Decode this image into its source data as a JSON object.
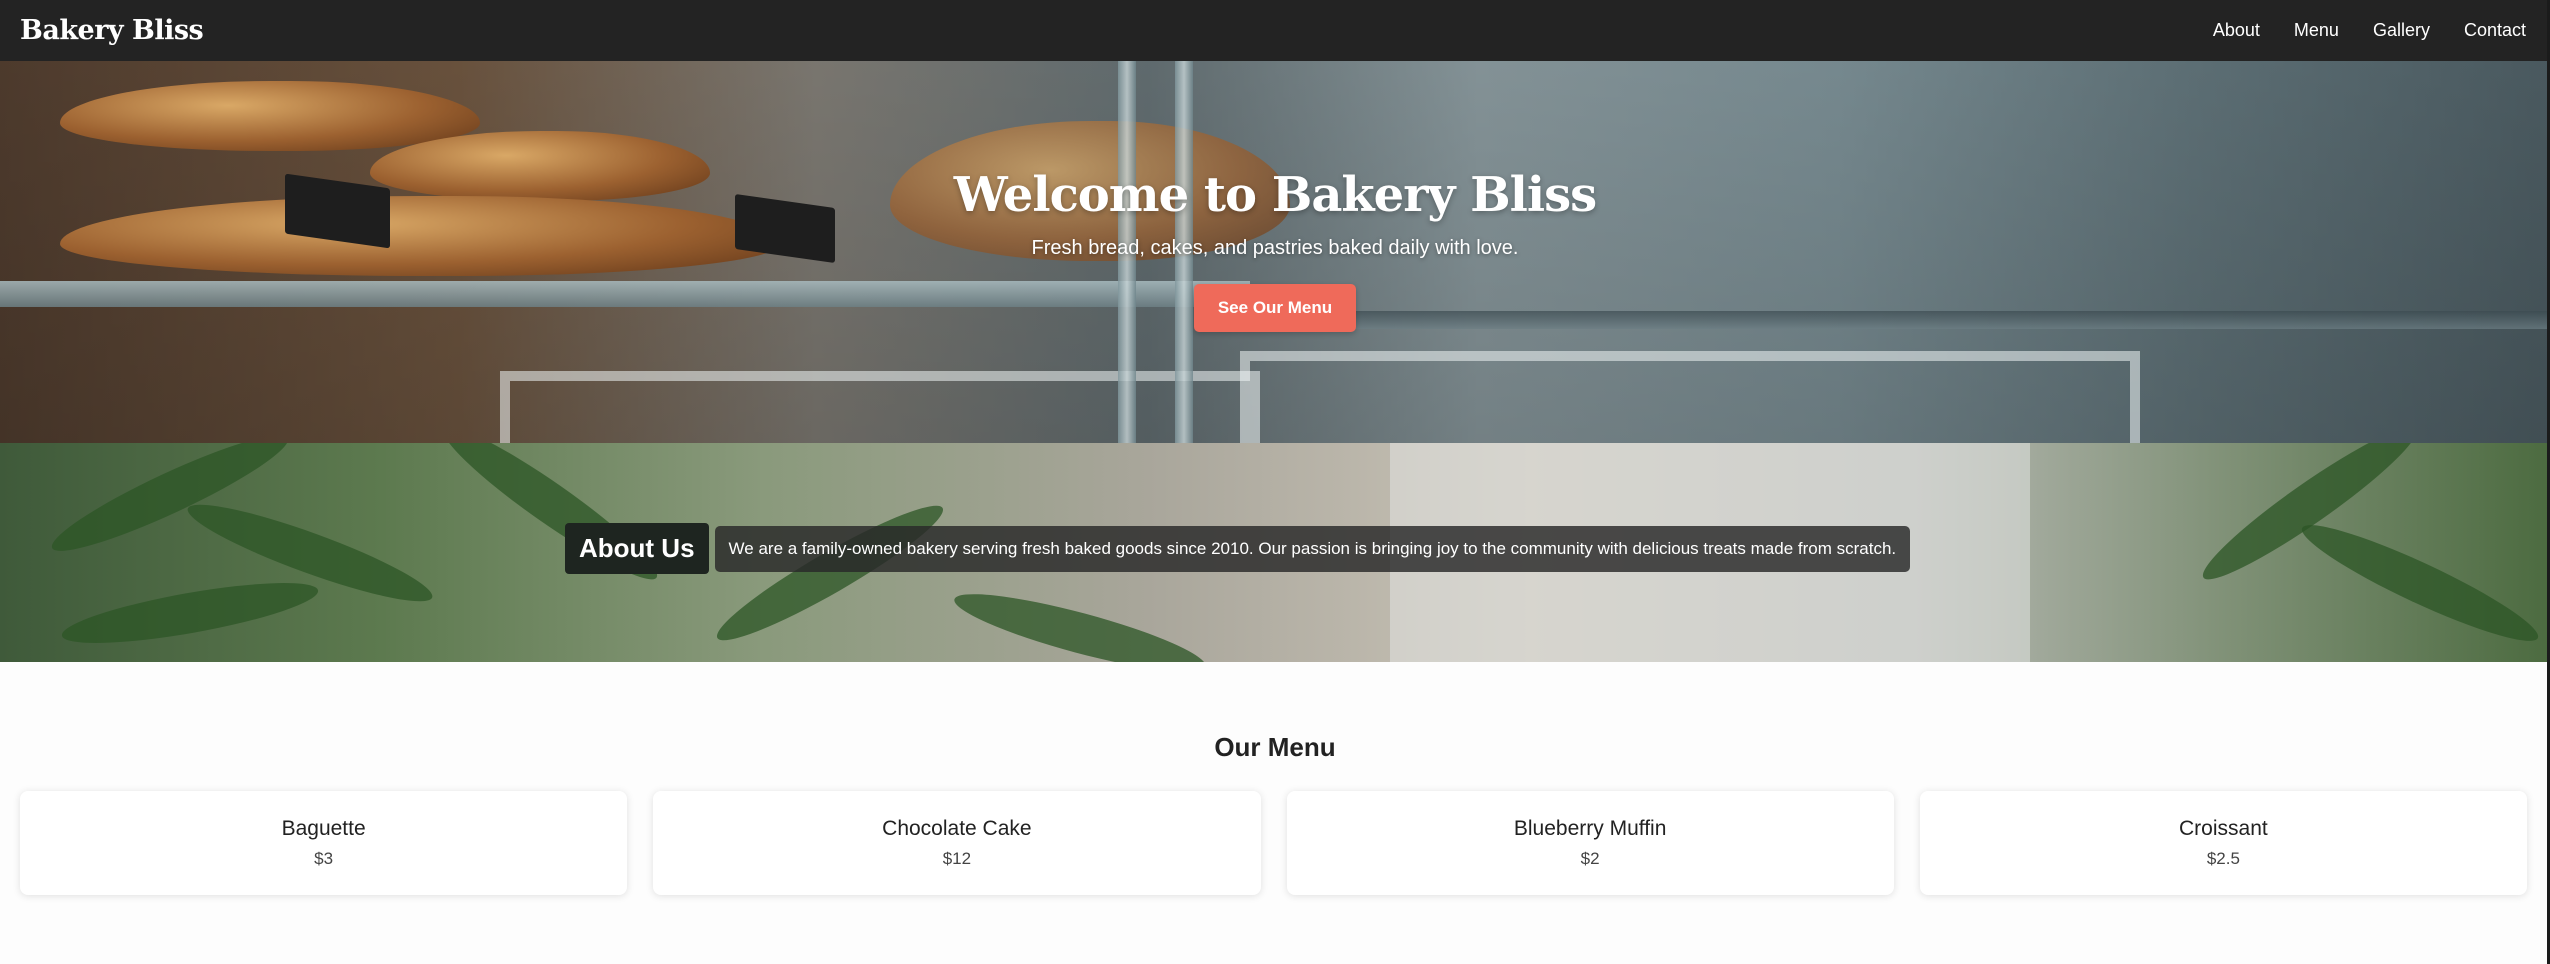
{
  "nav": {
    "brand": "Bakery Bliss",
    "links": [
      "About",
      "Menu",
      "Gallery",
      "Contact"
    ]
  },
  "hero": {
    "title": "Welcome to Bakery Bliss",
    "subtitle": "Fresh bread, cakes, and pastries baked daily with love.",
    "cta_label": "See Our Menu"
  },
  "about": {
    "heading": "About Us",
    "text": "We are a family-owned bakery serving fresh baked goods since 2010. Our passion is bringing joy to the community with delicious treats made from scratch."
  },
  "menu": {
    "title": "Our Menu",
    "items": [
      {
        "name": "Baguette",
        "price": "$3"
      },
      {
        "name": "Chocolate Cake",
        "price": "$12"
      },
      {
        "name": "Blueberry Muffin",
        "price": "$2"
      },
      {
        "name": "Croissant",
        "price": "$2.5"
      }
    ]
  },
  "colors": {
    "navbar_bg": "#232323",
    "cta_bg": "#ef6a5a"
  }
}
